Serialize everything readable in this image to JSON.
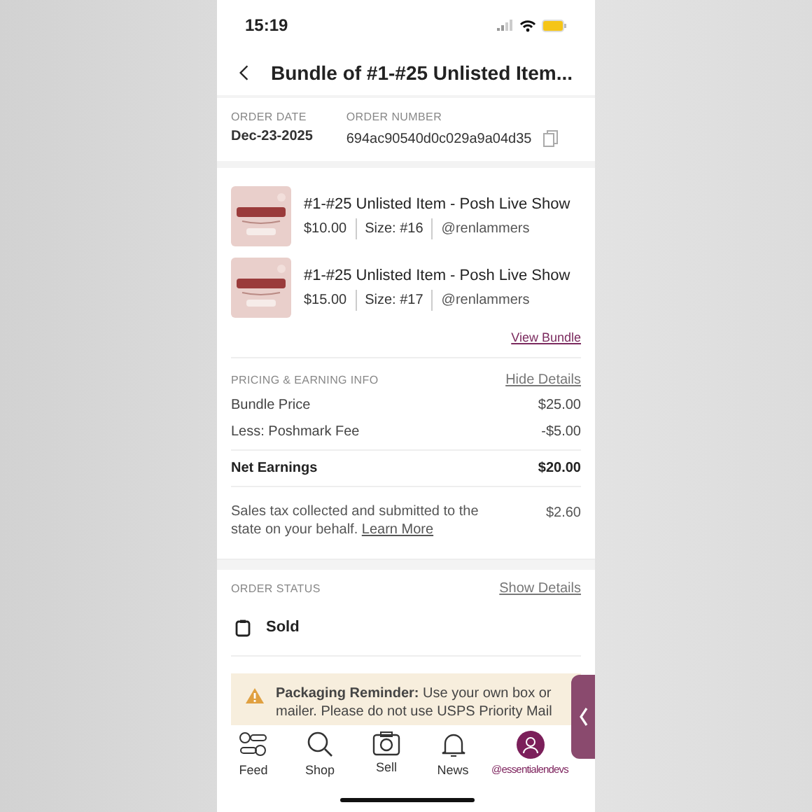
{
  "status_bar": {
    "time": "15:19"
  },
  "header": {
    "title": "Bundle of #1-#25 Unlisted Item..."
  },
  "order": {
    "date_label": "ORDER DATE",
    "date": "Dec-23-2025",
    "number_label": "ORDER NUMBER",
    "number": "694ac90540d0c029a9a04d35"
  },
  "items": [
    {
      "title": "#1-#25 Unlisted Item - Posh Live Show",
      "price": "$10.00",
      "size": "Size: #16",
      "seller": "@renlammers"
    },
    {
      "title": "#1-#25 Unlisted Item - Posh Live Show",
      "price": "$15.00",
      "size": "Size: #17",
      "seller": "@renlammers"
    }
  ],
  "view_bundle": "View Bundle",
  "pricing": {
    "heading": "PRICING & EARNING INFO",
    "toggle": "Hide Details",
    "rows": [
      {
        "label": "Bundle Price",
        "value": "$25.00",
        "bold": false
      },
      {
        "label": "Less: Poshmark Fee",
        "value": "-$5.00",
        "bold": false
      },
      {
        "label": "Net Earnings",
        "value": "$20.00",
        "bold": true
      }
    ],
    "tax_note": "Sales tax collected and submitted to the state on your behalf.",
    "tax_link": "Learn More",
    "tax_value": "$2.60"
  },
  "order_status": {
    "heading": "ORDER STATUS",
    "toggle": "Show Details",
    "status": "Sold"
  },
  "reminder": "**Packaging Reminder:** Use your own box or mailer. Please do not use USPS Priority Mail",
  "tabs": [
    {
      "label": "Feed",
      "kind": "feed",
      "selected": false
    },
    {
      "label": "Shop",
      "kind": "shop",
      "selected": false
    },
    {
      "label": "Sell",
      "kind": "sell",
      "selected": false
    },
    {
      "label": "News",
      "kind": "news",
      "selected": false
    },
    {
      "label": "@essentialendevs",
      "kind": "profile",
      "selected": true
    }
  ]
}
